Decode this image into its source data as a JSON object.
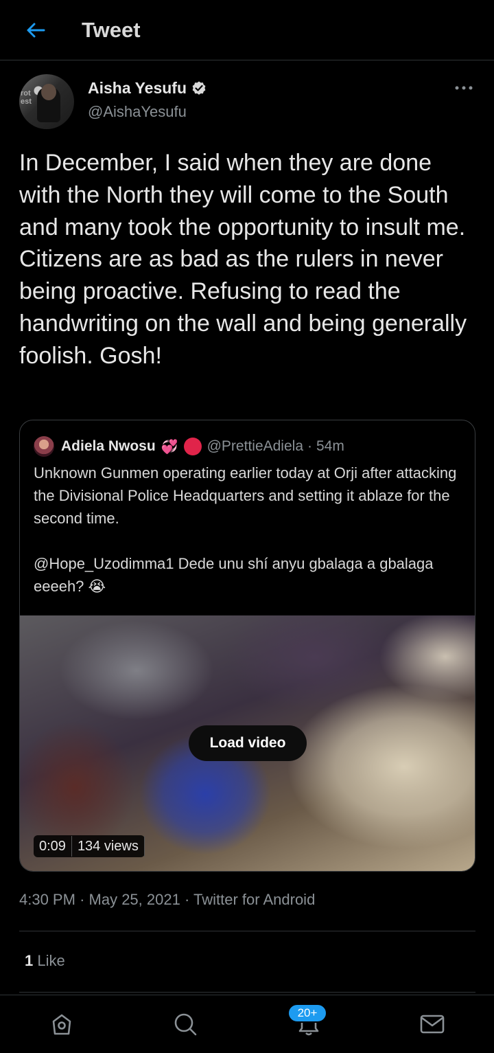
{
  "header": {
    "title": "Tweet"
  },
  "tweet": {
    "author": {
      "display_name": "Aisha Yesufu",
      "handle": "@AishaYesufu",
      "avatar_text": "rot\nest"
    },
    "text": "In December, I said when they are done with the North they will come to the South and many took the opportunity to insult me. Citizens are as bad as the rulers in never being proactive. Refusing to read the handwriting on the wall and being generally foolish. Gosh!",
    "time": "4:30 PM",
    "date": "May 25, 2021",
    "source": "Twitter for Android",
    "likes_count": "1",
    "likes_label": "Like"
  },
  "quoted_tweet": {
    "display_name": "Adiela Nwosu",
    "emoji": "💞",
    "handle": "@PrettieAdiela",
    "separator": "·",
    "time_ago": "54m",
    "paragraph1": "Unknown Gunmen operating earlier today at Orji after attacking the Divisional Police Headquarters and setting it ablaze for the second time.",
    "paragraph2": "@Hope_Uzodimma1 Dede unu shí anyu gbalaga a gbalaga eeeeh? 😭",
    "media": {
      "load_label": "Load video",
      "duration": "0:09",
      "views": "134 views"
    }
  },
  "nav": {
    "notifications_badge": "20+"
  },
  "icons": {
    "back": "arrow-left-icon",
    "verified": "verified-badge-icon",
    "more": "more-dots-icon",
    "home": "home-icon",
    "search": "search-icon",
    "notifications": "bell-icon",
    "messages": "mail-icon"
  },
  "colors": {
    "accent": "#1d9bf0",
    "background": "#000000",
    "muted_text": "#8b9196",
    "primary_text": "#e7e7e7"
  }
}
